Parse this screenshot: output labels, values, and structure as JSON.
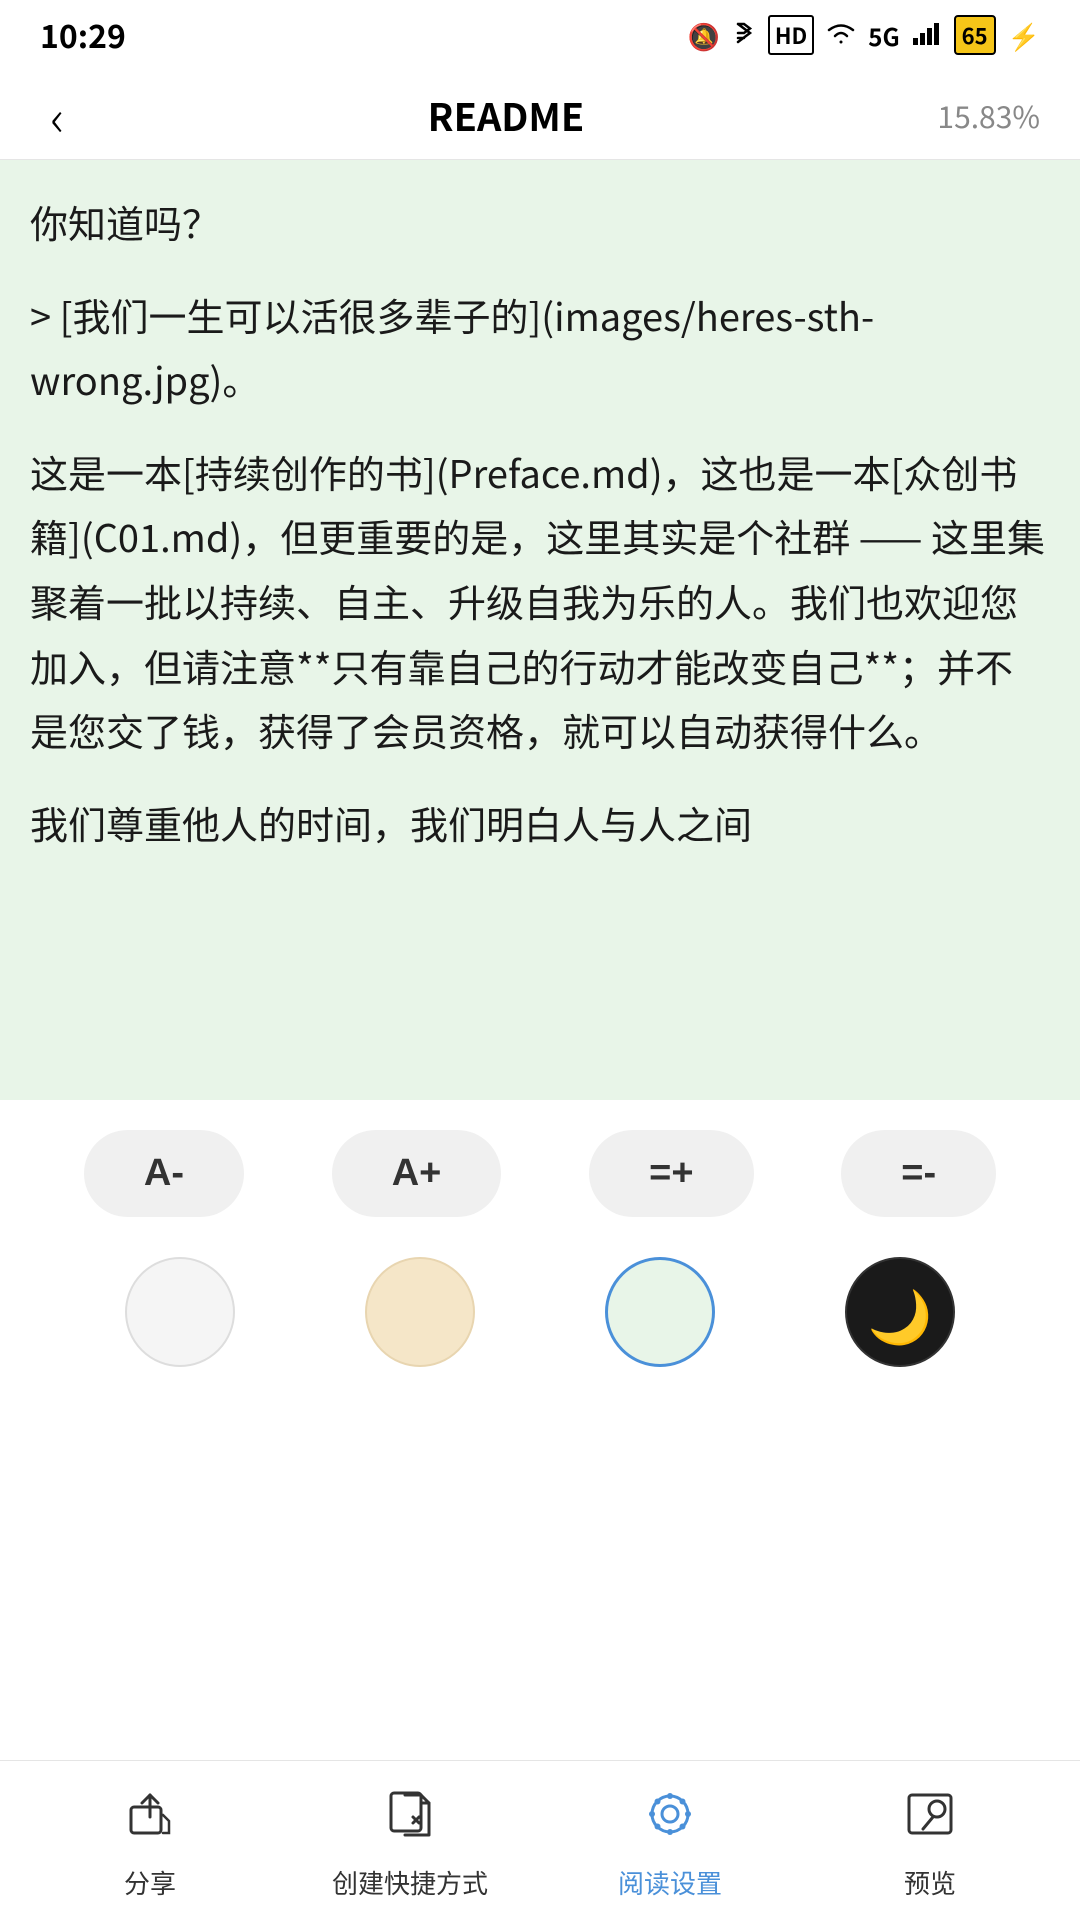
{
  "statusBar": {
    "time": "10:29",
    "battery": "65",
    "icons": [
      "mute",
      "bluetooth",
      "hd",
      "wifi",
      "signal",
      "battery",
      "charge"
    ]
  },
  "navBar": {
    "backLabel": "‹",
    "title": "README",
    "progress": "15.83%"
  },
  "readingContent": {
    "paragraph1": "你知道吗？",
    "paragraph2": "> [我们一生可以活很多辈子的](images/heres-sth-wrong.jpg)。",
    "paragraph3": "这是一本[持续创作的书](Preface.md)，这也是一本[众创书籍](C01.md)，但更重要的是，这里其实是个社群 —— 这里集聚着一批以持续、自主、升级自我为乐的人。我们也欢迎您加入，但请注意**只有靠自己的行动才能改变自己**；并不是您交了钱，获得了会员资格，就可以自动获得什么。",
    "paragraph4": "我们尊重他人的时间，我们明白人与人之间"
  },
  "fontControls": {
    "decreaseFont": "A-",
    "increaseFont": "A+",
    "increaseSpacing": "=+",
    "decreaseSpacing": "=-"
  },
  "themeColors": {
    "white": "#f5f5f5",
    "cream": "#f5e6c8",
    "green": "#e8f5e8",
    "night": "#1a1a1a",
    "nightIcon": "🌙"
  },
  "bottomNav": {
    "items": [
      {
        "label": "分享",
        "iconType": "share"
      },
      {
        "label": "创建快捷方式",
        "iconType": "shortcut"
      },
      {
        "label": "阅读设置",
        "iconType": "settings",
        "active": true
      },
      {
        "label": "预览",
        "iconType": "preview"
      }
    ]
  }
}
